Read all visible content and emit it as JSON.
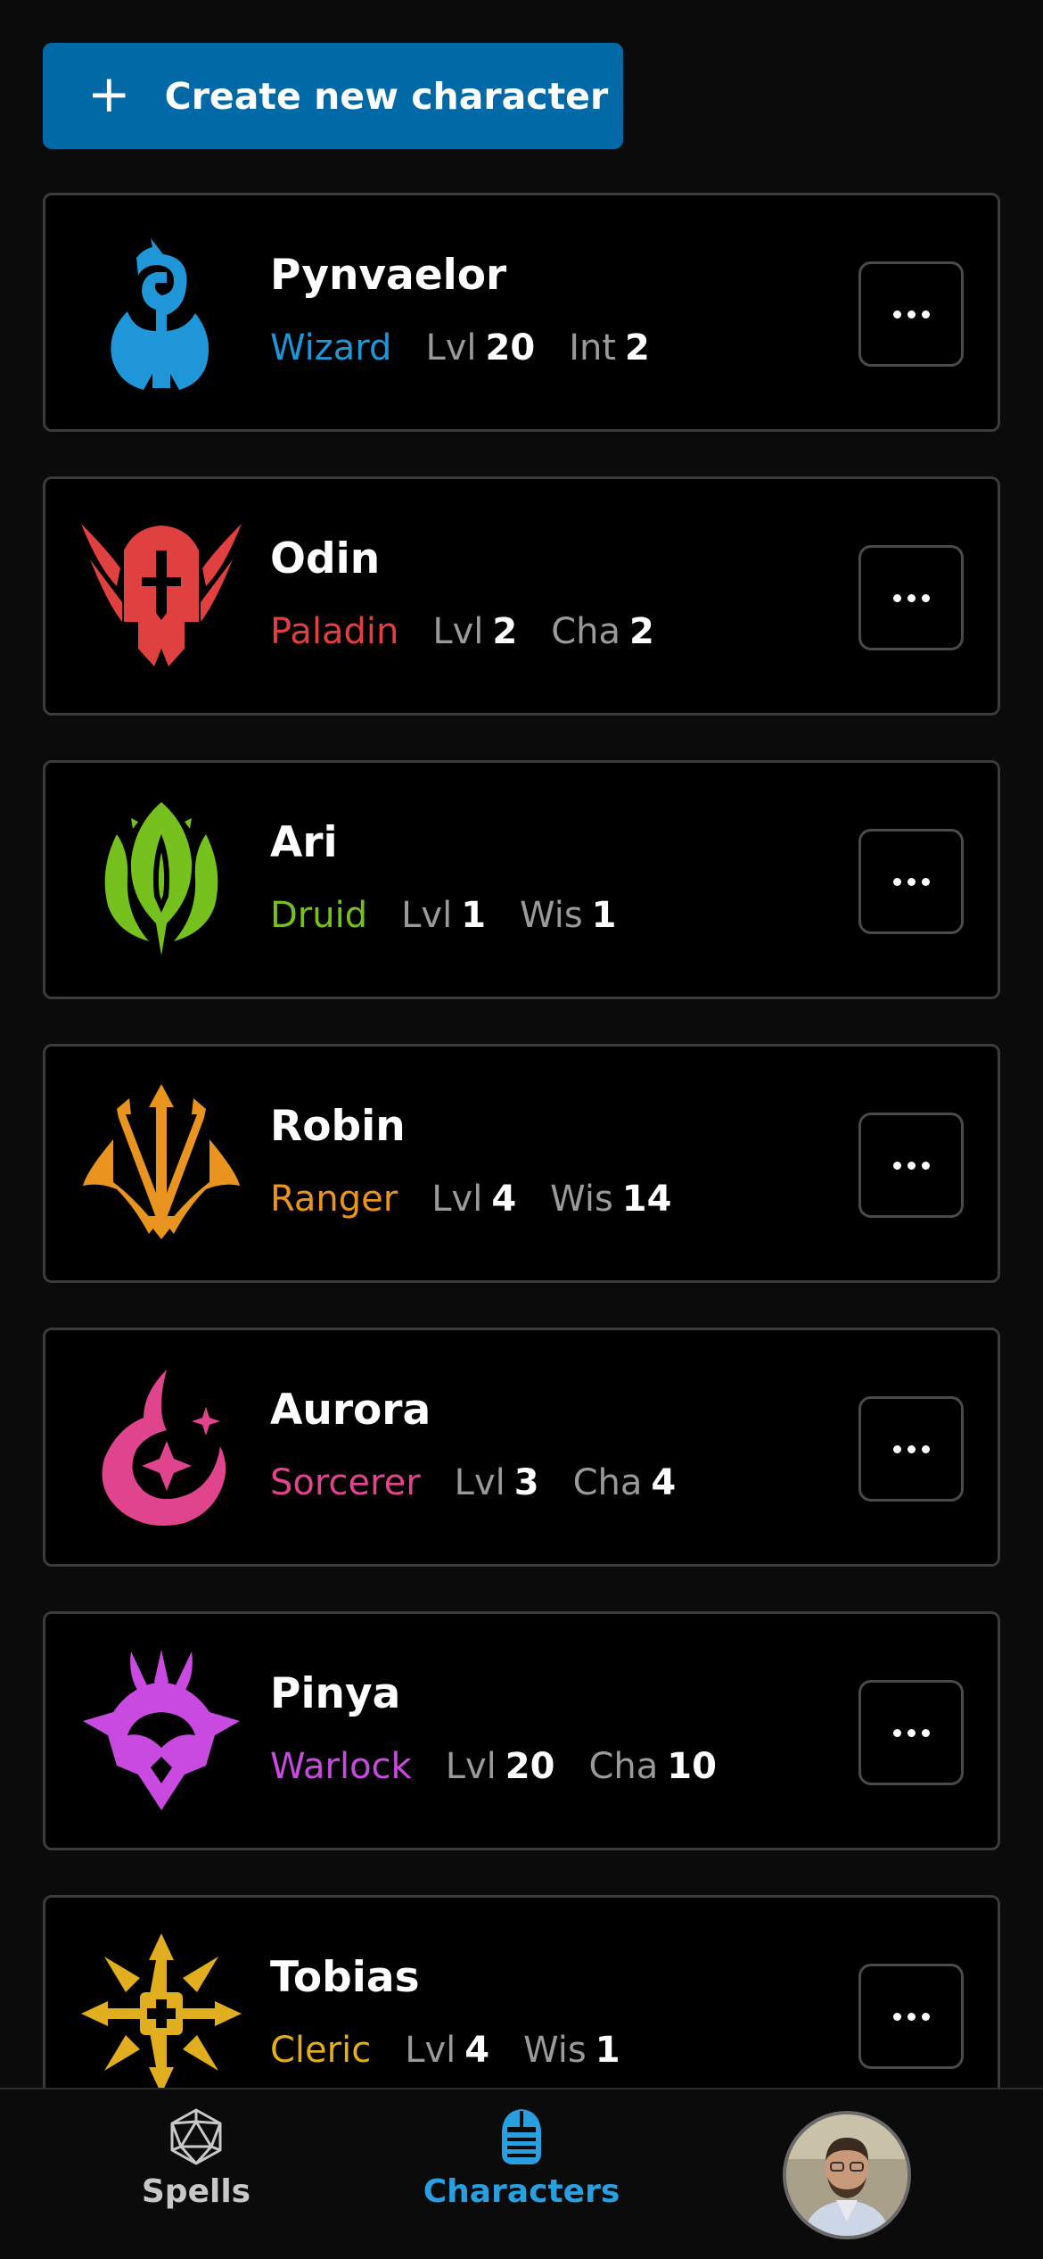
{
  "create_button": {
    "label": "Create new character",
    "icon": "plus-icon"
  },
  "characters": [
    {
      "name": "Pynvaelor",
      "class": "Wizard",
      "class_color": "#1e96d8",
      "level_label": "Lvl",
      "level": "20",
      "stat_label": "Int",
      "stat_value": "2",
      "emblem": "wizard-emblem-icon"
    },
    {
      "name": "Odin",
      "class": "Paladin",
      "class_color": "#e04040",
      "level_label": "Lvl",
      "level": "2",
      "stat_label": "Cha",
      "stat_value": "2",
      "emblem": "paladin-emblem-icon"
    },
    {
      "name": "Ari",
      "class": "Druid",
      "class_color": "#77c11e",
      "level_label": "Lvl",
      "level": "1",
      "stat_label": "Wis",
      "stat_value": "1",
      "emblem": "druid-emblem-icon"
    },
    {
      "name": "Robin",
      "class": "Ranger",
      "class_color": "#e8941e",
      "level_label": "Lvl",
      "level": "4",
      "stat_label": "Wis",
      "stat_value": "14",
      "emblem": "ranger-emblem-icon"
    },
    {
      "name": "Aurora",
      "class": "Sorcerer",
      "class_color": "#e0448c",
      "level_label": "Lvl",
      "level": "3",
      "stat_label": "Cha",
      "stat_value": "4",
      "emblem": "sorcerer-emblem-icon"
    },
    {
      "name": "Pinya",
      "class": "Warlock",
      "class_color": "#c84ae0",
      "level_label": "Lvl",
      "level": "20",
      "stat_label": "Cha",
      "stat_value": "10",
      "emblem": "warlock-emblem-icon"
    },
    {
      "name": "Tobias",
      "class": "Cleric",
      "class_color": "#e0ae1e",
      "level_label": "Lvl",
      "level": "4",
      "stat_label": "Wis",
      "stat_value": "1",
      "emblem": "cleric-emblem-icon"
    }
  ],
  "tabbar": {
    "spells": {
      "label": "Spells",
      "icon": "d20-icon"
    },
    "characters": {
      "label": "Characters",
      "icon": "knight-helmet-icon",
      "active": true
    },
    "profile": {
      "icon": "avatar"
    }
  },
  "colors": {
    "background": "#0b0b0b",
    "accent": "#0069a6",
    "active_tab": "#2a9fe0"
  }
}
